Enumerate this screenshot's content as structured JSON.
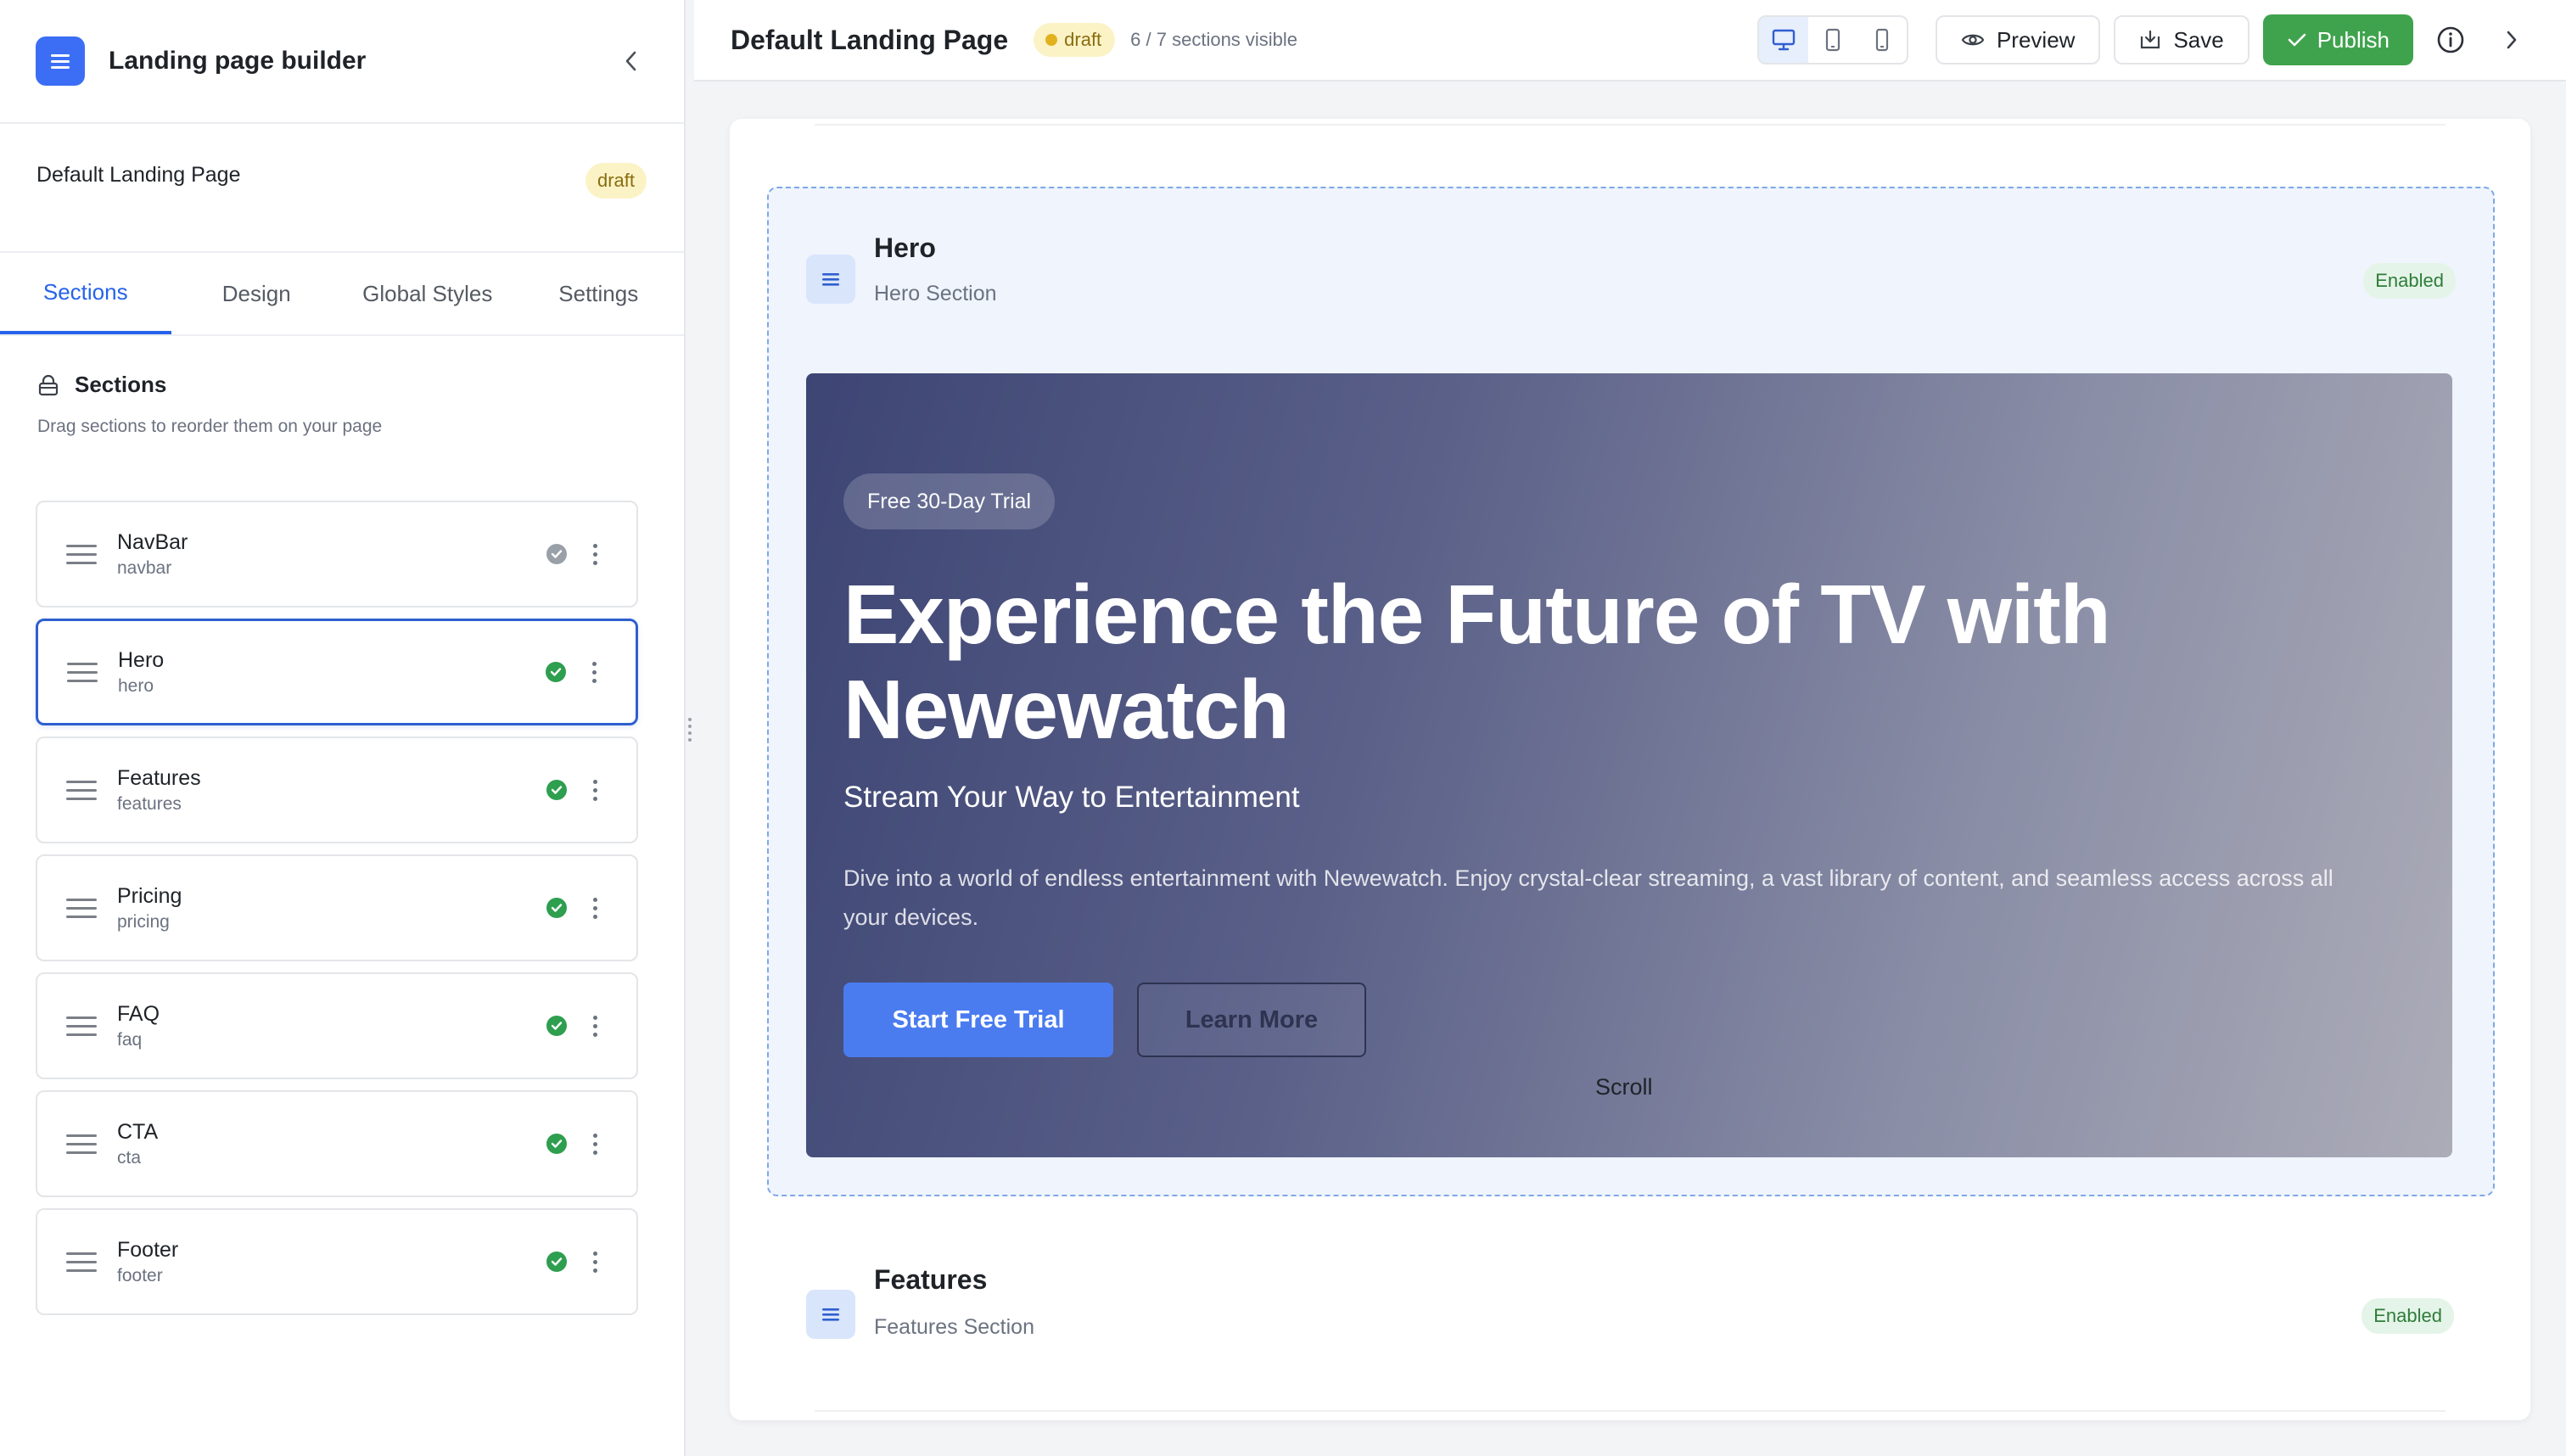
{
  "sidebar": {
    "app_title": "Landing page builder",
    "page_name": "Default Landing Page",
    "page_status": "draft",
    "tabs": [
      {
        "label": "Sections"
      },
      {
        "label": "Design"
      },
      {
        "label": "Global Styles"
      },
      {
        "label": "Settings"
      }
    ],
    "sections_title": "Sections",
    "sections_hint": "Drag sections to reorder them on your page",
    "items": [
      {
        "name": "NavBar",
        "key": "navbar",
        "status": "muted"
      },
      {
        "name": "Hero",
        "key": "hero",
        "status": "enabled",
        "selected": true
      },
      {
        "name": "Features",
        "key": "features",
        "status": "enabled"
      },
      {
        "name": "Pricing",
        "key": "pricing",
        "status": "enabled"
      },
      {
        "name": "FAQ",
        "key": "faq",
        "status": "enabled"
      },
      {
        "name": "CTA",
        "key": "cta",
        "status": "enabled"
      },
      {
        "name": "Footer",
        "key": "footer",
        "status": "enabled"
      }
    ]
  },
  "topbar": {
    "title": "Default Landing Page",
    "status": "draft",
    "visible_count": "6 / 7 sections visible",
    "preview_label": "Preview",
    "save_label": "Save",
    "publish_label": "Publish",
    "active_device": "desktop"
  },
  "canvas": {
    "hero_block": {
      "name": "Hero",
      "subtitle": "Hero Section",
      "status": "Enabled",
      "preview": {
        "badge": "Free 30-Day Trial",
        "heading": "Experience the Future of TV with Newewatch",
        "subheading": "Stream Your Way to Entertainment",
        "description": "Dive into a world of endless entertainment with Newewatch. Enjoy crystal-clear streaming, a vast library of content, and seamless access across all your devices.",
        "primary_cta": "Start Free Trial",
        "secondary_cta": "Learn More",
        "scroll_label": "Scroll"
      }
    },
    "features_block": {
      "name": "Features",
      "subtitle": "Features Section",
      "status": "Enabled"
    }
  },
  "colors": {
    "accent": "#2563eb",
    "publish": "#3fa34d",
    "draft_bg": "#fbf3c6",
    "enabled_bg": "#e5f4e8"
  }
}
